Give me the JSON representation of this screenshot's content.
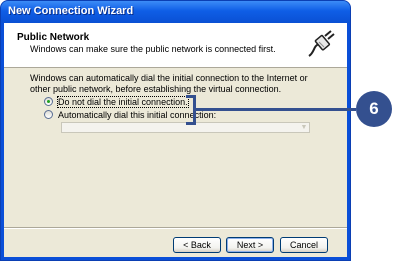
{
  "window": {
    "title": "New Connection Wizard"
  },
  "header": {
    "title": "Public Network",
    "subtitle": "Windows can make sure the public network is connected first.",
    "icon": "network-cable-icon"
  },
  "body": {
    "intro": "Windows can automatically dial the initial connection to the Internet or other public network, before establishing the virtual connection.",
    "options": [
      {
        "label": "Do not dial the initial connection.",
        "selected": true
      },
      {
        "label": "Automatically dial this initial connection:",
        "selected": false
      }
    ],
    "connection_select": {
      "value": "",
      "disabled": true
    }
  },
  "buttons": {
    "back": "< Back",
    "next": "Next >",
    "cancel": "Cancel"
  },
  "callout": {
    "number": "6"
  },
  "colors": {
    "title_bar": "#0a50d4",
    "dialog_face": "#ece9d8",
    "callout": "#34508f",
    "radio_dot": "#21a121"
  }
}
